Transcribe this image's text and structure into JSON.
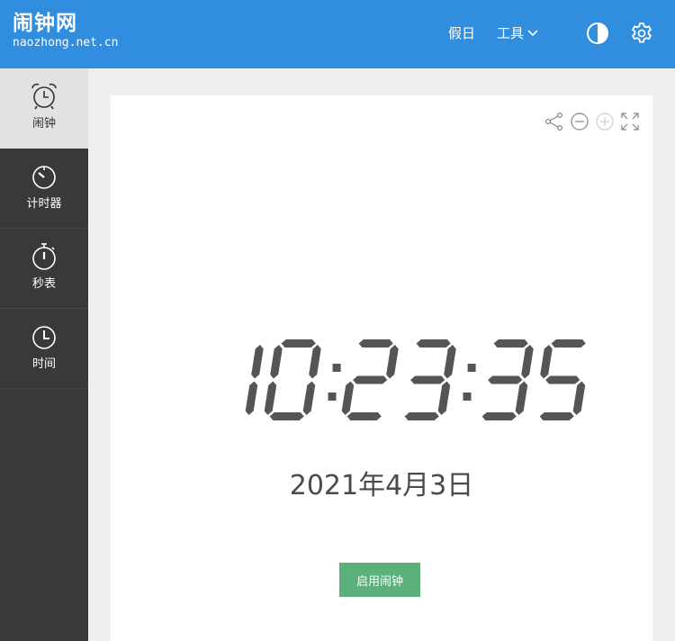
{
  "header": {
    "brand_title": "闹钟网",
    "brand_subtitle": "naozhong.net.cn",
    "nav_holiday": "假日",
    "nav_tools": "工具",
    "theme_icon": "contrast-icon",
    "settings_icon": "gear-icon"
  },
  "sidebar": {
    "items": [
      {
        "label": "闹钟",
        "icon": "alarm-clock-icon",
        "active": true
      },
      {
        "label": "计时器",
        "icon": "timer-icon",
        "active": false
      },
      {
        "label": "秒表",
        "icon": "stopwatch-icon",
        "active": false
      },
      {
        "label": "时间",
        "icon": "clock-icon",
        "active": false
      }
    ]
  },
  "panel": {
    "tools": [
      "share-icon",
      "zoom-out-icon",
      "zoom-in-icon",
      "fullscreen-icon"
    ],
    "time": "10:23:35",
    "date": "2021年4月3日",
    "alarm_button": "启用闹钟"
  },
  "colors": {
    "header_bg": "#318dde",
    "sidebar_bg": "#393939",
    "active_item_bg": "#e2e2e2",
    "digit_color": "#555555",
    "button_bg": "#5cb17a"
  }
}
